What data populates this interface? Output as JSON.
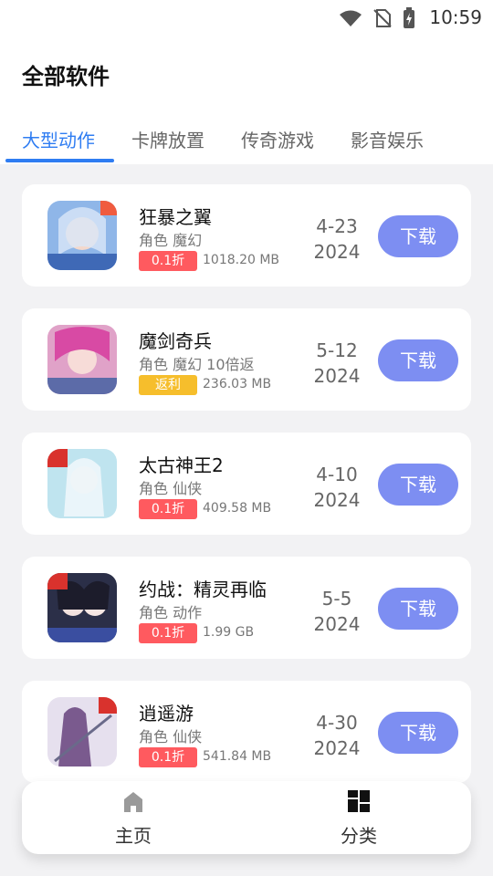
{
  "status_bar": {
    "time": "10:59"
  },
  "header": {
    "title": "全部软件"
  },
  "tabs": [
    {
      "label": "大型动作",
      "active": true
    },
    {
      "label": "卡牌放置",
      "active": false
    },
    {
      "label": "传奇游戏",
      "active": false
    },
    {
      "label": "影音娱乐",
      "active": false
    }
  ],
  "apps": [
    {
      "name": "狂暴之翼",
      "tags": "角色 魔幻",
      "badge": "0.1折",
      "badge_type": "red",
      "size": "1018.20 MB",
      "date_md": "4-23",
      "date_year": "2024",
      "download_label": "下载"
    },
    {
      "name": "魔剑奇兵",
      "tags": "角色 魔幻 10倍返",
      "badge": "返利",
      "badge_type": "gold",
      "size": "236.03 MB",
      "date_md": "5-12",
      "date_year": "2024",
      "download_label": "下载"
    },
    {
      "name": "太古神王2",
      "tags": "角色 仙侠",
      "badge": "0.1折",
      "badge_type": "red",
      "size": "409.58 MB",
      "date_md": "4-10",
      "date_year": "2024",
      "download_label": "下载"
    },
    {
      "name": "约战：精灵再临",
      "tags": "角色 动作",
      "badge": "0.1折",
      "badge_type": "red",
      "size": "1.99 GB",
      "date_md": "5-5",
      "date_year": "2024",
      "download_label": "下载"
    },
    {
      "name": "逍遥游",
      "tags": "角色 仙侠",
      "badge": "0.1折",
      "badge_type": "red",
      "size": "541.84 MB",
      "date_md": "4-30",
      "date_year": "2024",
      "download_label": "下载"
    }
  ],
  "bottom_nav": [
    {
      "label": "主页",
      "icon": "home-icon"
    },
    {
      "label": "分类",
      "icon": "grid-icon"
    }
  ],
  "colors": {
    "accent": "#2f7df2",
    "button": "#7d8ef2",
    "badge_red": "#ff5a5f",
    "badge_gold": "#f6be2c"
  }
}
